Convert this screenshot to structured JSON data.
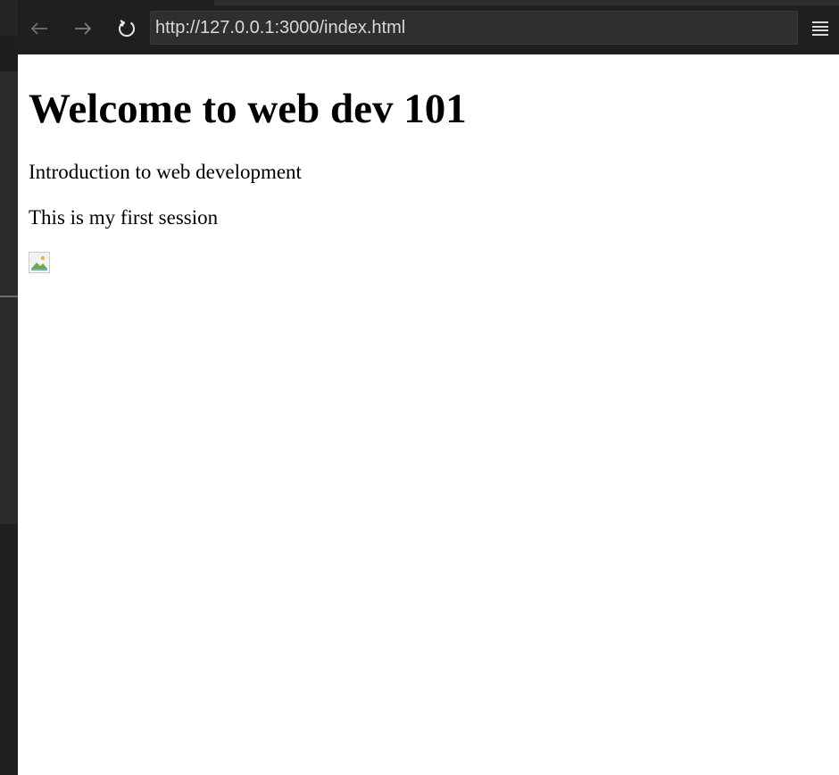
{
  "browser": {
    "url": "http://127.0.0.1:3000/index.html",
    "nav": {
      "back_icon": "arrow-left-icon",
      "forward_icon": "arrow-right-icon",
      "reload_icon": "reload-icon",
      "menu_icon": "menu-icon"
    }
  },
  "page": {
    "heading": "Welcome to web dev 101",
    "paragraphs": [
      "Introduction to web development",
      "This is my first session"
    ],
    "image": {
      "state": "broken-image-icon"
    }
  },
  "colors": {
    "toolbar_bg": "#1f1f1f",
    "url_bar_bg": "#2f2f2f",
    "page_bg": "#ffffff",
    "text": "#000000"
  }
}
